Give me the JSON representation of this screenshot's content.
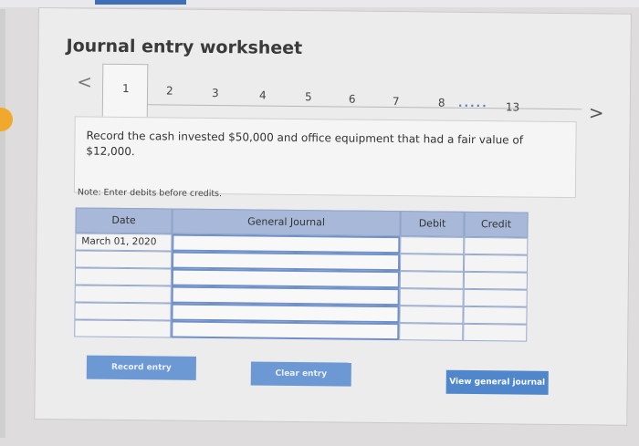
{
  "worksheet": {
    "title": "Journal entry worksheet",
    "nav_prev_glyph": "<",
    "nav_next_glyph": ">",
    "tabs": [
      "1",
      "2",
      "3",
      "4",
      "5",
      "6",
      "7",
      "8"
    ],
    "tab_ellipsis": ".....",
    "tab_last": "13",
    "active_tab": "1"
  },
  "question": {
    "text": "Record the cash invested $50,000 and office equipment that had a fair value of $12,000."
  },
  "note": "Note: Enter debits before credits.",
  "journal": {
    "headers": {
      "date": "Date",
      "account": "General Journal",
      "debit": "Debit",
      "credit": "Credit"
    },
    "rows": [
      {
        "date": "March 01, 2020",
        "account": "",
        "debit": "",
        "credit": ""
      },
      {
        "date": "",
        "account": "",
        "debit": "",
        "credit": ""
      },
      {
        "date": "",
        "account": "",
        "debit": "",
        "credit": ""
      },
      {
        "date": "",
        "account": "",
        "debit": "",
        "credit": ""
      },
      {
        "date": "",
        "account": "",
        "debit": "",
        "credit": ""
      },
      {
        "date": "",
        "account": "",
        "debit": "",
        "credit": ""
      }
    ]
  },
  "buttons": {
    "record": "Record entry",
    "clear": "Clear entry",
    "view": "View general journal"
  }
}
